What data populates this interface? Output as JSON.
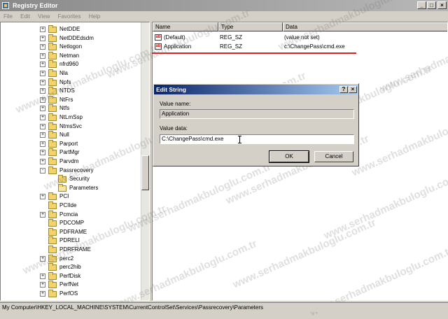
{
  "window": {
    "title": "Registry Editor",
    "controls": {
      "minimize": "_",
      "maximize": "□",
      "close": "×"
    }
  },
  "menu": [
    "File",
    "Edit",
    "View",
    "Favorites",
    "Help"
  ],
  "tree": {
    "items": [
      {
        "label": "NetDDE",
        "expander": "+"
      },
      {
        "label": "NetDDEdsdm",
        "expander": "+"
      },
      {
        "label": "Netlogon",
        "expander": "+"
      },
      {
        "label": "Netman",
        "expander": "+"
      },
      {
        "label": "nfrd960",
        "expander": "+"
      },
      {
        "label": "Nla",
        "expander": "+"
      },
      {
        "label": "Npfs",
        "expander": "+"
      },
      {
        "label": "NTDS",
        "expander": "+"
      },
      {
        "label": "NtFrs",
        "expander": "+"
      },
      {
        "label": "Ntfs",
        "expander": "+"
      },
      {
        "label": "NtLmSsp",
        "expander": "+"
      },
      {
        "label": "NtmsSvc",
        "expander": "+"
      },
      {
        "label": "Null",
        "expander": "+"
      },
      {
        "label": "Parport",
        "expander": "+"
      },
      {
        "label": "PartMgr",
        "expander": "+"
      },
      {
        "label": "Parvdm",
        "expander": "+"
      },
      {
        "label": "Passrecovery",
        "expander": "-"
      },
      {
        "label": "Security",
        "expander": ""
      },
      {
        "label": "Parameters",
        "expander": ""
      },
      {
        "label": "PCI",
        "expander": "+"
      },
      {
        "label": "PCIIde",
        "expander": ""
      },
      {
        "label": "Pcmcia",
        "expander": "+"
      },
      {
        "label": "PDCOMP",
        "expander": ""
      },
      {
        "label": "PDFRAME",
        "expander": ""
      },
      {
        "label": "PDRELI",
        "expander": ""
      },
      {
        "label": "PDRFRAME",
        "expander": ""
      },
      {
        "label": "perc2",
        "expander": "+"
      },
      {
        "label": "perc2hib",
        "expander": ""
      },
      {
        "label": "PerfDisk",
        "expander": "+"
      },
      {
        "label": "PerfNet",
        "expander": "+"
      },
      {
        "label": "PerfOS",
        "expander": "+"
      }
    ]
  },
  "list": {
    "columns": [
      "Name",
      "Type",
      "Data"
    ],
    "rows": [
      {
        "icon": "ab",
        "name": "(Default)",
        "type": "REG_SZ",
        "data": "(value not set)"
      },
      {
        "icon": "ab",
        "name": "Application",
        "type": "REG_SZ",
        "data": "c:\\ChangePass\\cmd.exe"
      }
    ]
  },
  "dialog": {
    "title": "Edit String",
    "help_button": "?",
    "close_button": "×",
    "value_name_label": "Value name:",
    "value_name": "Application",
    "value_data_label": "Value data:",
    "value_data": "C:\\ChangePass\\cmd.exe",
    "ok_label": "OK",
    "cancel_label": "Cancel"
  },
  "status": "My Computer\\HKEY_LOCAL_MACHINE\\SYSTEM\\CurrentControlSet\\Services\\Passrecovery\\Parameters",
  "watermark": "www.serhadmakbuloglu.com.tr",
  "colors": {
    "annotation_red": "#e02020",
    "dialog_title_start": "#0a246a",
    "dialog_title_end": "#a6caf0",
    "folder": "#f3d36b"
  }
}
